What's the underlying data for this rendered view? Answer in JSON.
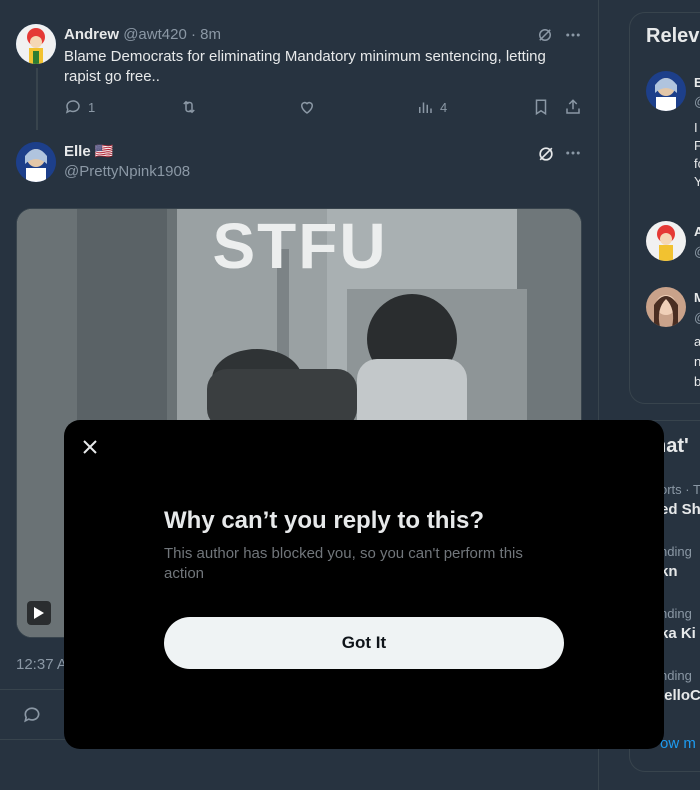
{
  "tweet1": {
    "name": "Andrew",
    "handle_time": "@awt420 · 8m",
    "text": "Blame Democrats for eliminating Mandatory minimum sentencing, letting rapist go free..",
    "reply_count": "1",
    "views_count": "4"
  },
  "tweet2": {
    "name": "Elle",
    "flag": "🇺🇸",
    "handle": "@PrettyNpink1908",
    "media_caption": "STFU",
    "timestamp": "12:37 A"
  },
  "sidebar": {
    "relevant_title": "Relev",
    "whats_title": "hat'",
    "relevant_items": [
      {
        "initial": "E",
        "handle": "@",
        "lines": [
          "I",
          "F",
          "fo",
          "Y"
        ]
      },
      {
        "initial": "A",
        "handle": "@"
      },
      {
        "initial": "M",
        "handle": "@",
        "lines": [
          "a",
          "n",
          "b"
        ]
      }
    ],
    "trends": [
      {
        "meta": "orts · T",
        "title": "ed Sh"
      },
      {
        "meta": "nding",
        "title": "kn"
      },
      {
        "meta": "nding",
        "title": "ka Ki"
      },
      {
        "meta": "nding",
        "title": "lelloC"
      }
    ],
    "show_more": "ow m"
  },
  "modal": {
    "title": "Why can’t you reply to this?",
    "body": "This author has blocked you, so you can't perform this action",
    "button": "Got It"
  },
  "colors": {
    "background": "#273340",
    "modal_bg": "#000000",
    "button_bg": "#eff3f4"
  }
}
